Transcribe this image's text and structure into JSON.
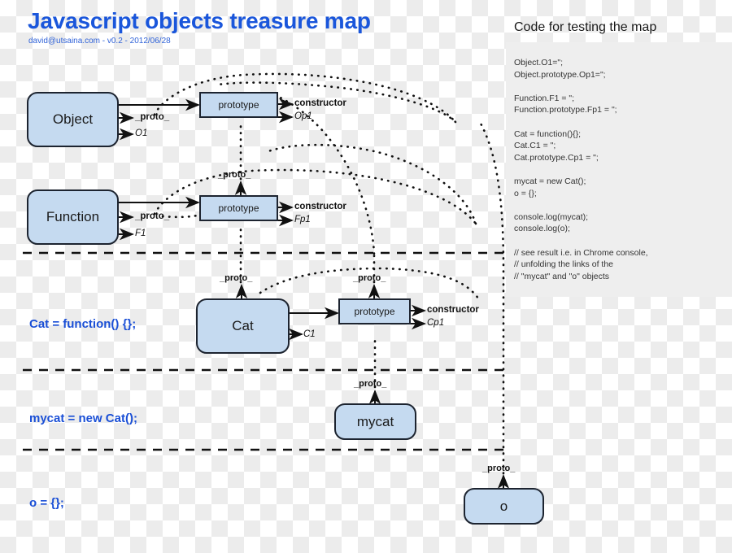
{
  "header": {
    "title": "Javascript objects treasure map",
    "subtitle": "david@utsaina.com - v0.2 - 2012/06/28"
  },
  "code_panel": {
    "heading": "Code for testing the map",
    "body": "Object.O1=\";\nObject.prototype.Op1=\";\n\nFunction.F1 = \";\nFunction.prototype.Fp1 = \";\n\nCat = function(){};\nCat.C1 = \";\nCat.prototype.Cp1 = \";\n\nmycat = new Cat();\no = {};\n\nconsole.log(mycat);\nconsole.log(o);\n\n// see result i.e. in Chrome console,\n// unfolding the links of the\n// \"mycat\" and \"o\" objects"
  },
  "colors": {
    "node_fill": "#c5daf0",
    "node_stroke": "#1d2430",
    "accent_blue": "#1a4fd6",
    "title_blue": "#1a56db",
    "panel_bg": "#eeeeee"
  },
  "nodes": {
    "object": "Object",
    "object_prototype": "prototype",
    "function": "Function",
    "function_prototype": "prototype",
    "cat": "Cat",
    "cat_prototype": "prototype",
    "mycat": "mycat",
    "o": "o"
  },
  "labels": {
    "proto": "_proto_",
    "constructor": "constructor",
    "object_own": "O1",
    "object_proto_prop": "Op1",
    "function_own": "F1",
    "function_proto_prop": "Fp1",
    "cat_own": "C1",
    "cat_proto_prop": "Cp1"
  },
  "section_captions": {
    "cat": "Cat = function() {};",
    "mycat": "mycat = new Cat();",
    "o": "o = {};"
  }
}
